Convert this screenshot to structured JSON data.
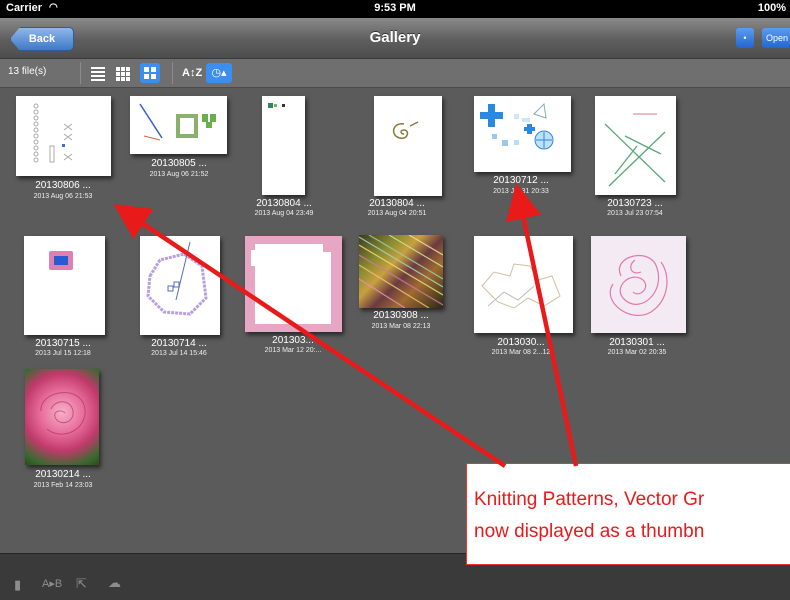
{
  "status_bar": {
    "carrier": "Carrier",
    "time": "9:53 PM",
    "battery": "100%"
  },
  "nav": {
    "back_label": "Back",
    "title": "Gallery",
    "small_button_label": "•",
    "open_label": "Open"
  },
  "toolbar": {
    "file_count": "13 file(s)",
    "sort_az_label": "A↕Z",
    "clock_label": "◷▴"
  },
  "items": [
    {
      "name": "20130806 ...",
      "date": "2013 Aug 06 21:53"
    },
    {
      "name": "20130805 ...",
      "date": "2013 Aug 06 21:52"
    },
    {
      "name": "20130804 ...",
      "date": "2013 Aug 04 23:49"
    },
    {
      "name": "20130804 ...",
      "date": "2013 Aug 04 20:51"
    },
    {
      "name": "20130712 ...",
      "date": "2013 Jul 31 20:33"
    },
    {
      "name": "20130723 ...",
      "date": "2013 Jul 23 07:54"
    },
    {
      "name": "20130715 ...",
      "date": "2013 Jul 15 12:18"
    },
    {
      "name": "20130714 ...",
      "date": "2013 Jul 14 15:46"
    },
    {
      "name": "201303...",
      "date": "2013 Mar 12 20:..."
    },
    {
      "name": "20130308 ...",
      "date": "2013 Mar 08 22:13"
    },
    {
      "name": "2013030...",
      "date": "2013 Mar 08 2...12"
    },
    {
      "name": "20130301 ...",
      "date": "2013 Mar 02 20:35"
    },
    {
      "name": "20130214 ...",
      "date": "2013 Feb 14 23:03"
    }
  ],
  "annotation": {
    "line1": "Knitting Patterns, Vector Gr",
    "line2": "now displayed as a thumbn"
  },
  "colors": {
    "accent": "#3d8ef0",
    "annotation_red": "#e81a1a",
    "background": "#5b5b5b"
  }
}
